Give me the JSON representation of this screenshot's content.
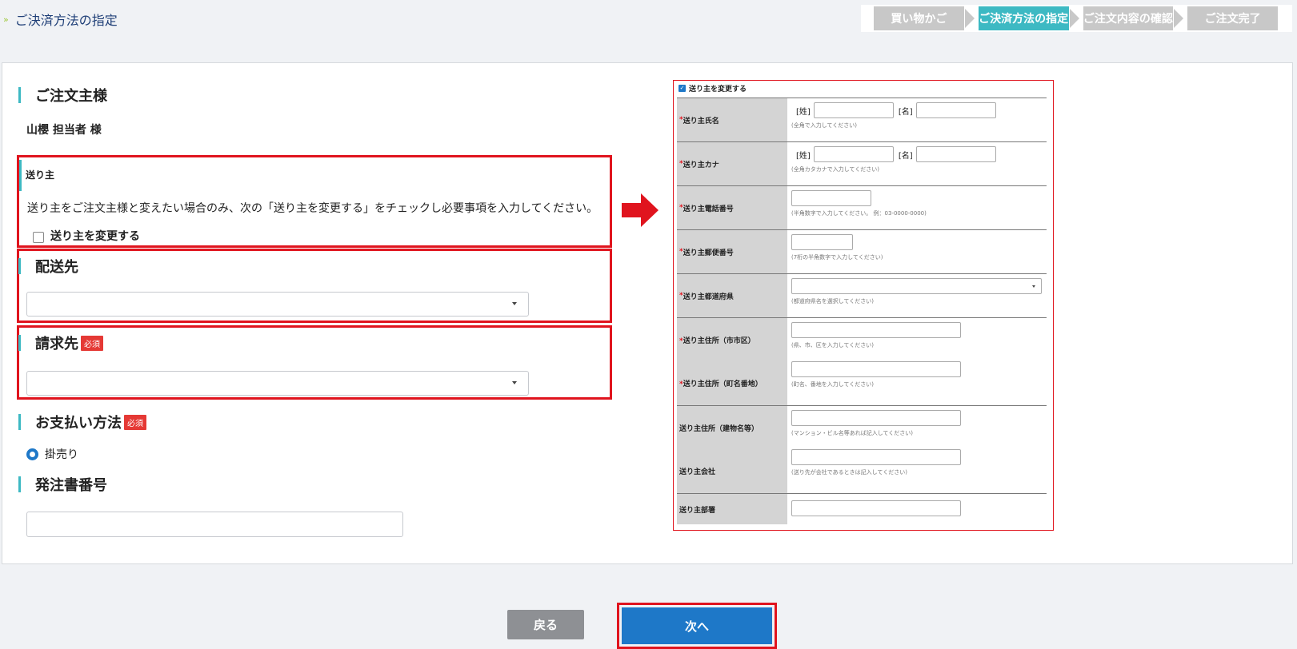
{
  "header": {
    "title": "ご決済方法の指定"
  },
  "steps": [
    {
      "label": "買い物かご",
      "active": false
    },
    {
      "label": "ご決済方法の指定",
      "active": true
    },
    {
      "label": "ご注文内容の確認",
      "active": false
    },
    {
      "label": "ご注文完了",
      "active": false
    }
  ],
  "orderer": {
    "title": "ご注文主様",
    "name": "山櫻 担当者 様"
  },
  "sender": {
    "label": "送り主",
    "description": "送り主をご注文主様と変えたい場合のみ、次の「送り主を変更する」をチェックし必要事項を入力してください。",
    "checkbox_label": "送り主を変更する",
    "checked": false
  },
  "delivery": {
    "title": "配送先",
    "value": ""
  },
  "billing": {
    "title": "請求先",
    "required_badge": "必須",
    "value": ""
  },
  "payment": {
    "title": "お支払い方法",
    "required_badge": "必須",
    "option": "掛売り"
  },
  "po_number": {
    "title": "発注書番号",
    "value": ""
  },
  "preview": {
    "checkbox_label": "送り主を変更する",
    "rows": {
      "name": {
        "label": "送り主氏名",
        "sei": "[姓]",
        "mei": "[名]",
        "note": "(全角で入力してください)"
      },
      "kana": {
        "label": "送り主カナ",
        "sei": "[姓]",
        "mei": "[名]",
        "note": "(全角カタカナで入力してください)"
      },
      "phone": {
        "label": "送り主電話番号",
        "note": "(半角数字で入力してください。 例：03-0000-0000)"
      },
      "zip": {
        "label": "送り主郵便番号",
        "note": "(7桁の半角数字で入力してください)"
      },
      "pref": {
        "label": "送り主都道府県",
        "note": "(都道府県名を選択してください)"
      },
      "city": {
        "label": "送り主住所（市市区）",
        "note": "(県、市、区を入力してください)"
      },
      "town": {
        "label": "送り主住所（町名番地）",
        "note": "(町名、番地を入力してください)"
      },
      "building": {
        "label": "送り主住所（建物名等）",
        "note": "(マンション・ビル名等あれば記入してください)"
      },
      "company": {
        "label": "送り主会社",
        "note": "(送り先が会社であるときは記入してください)"
      },
      "dept": {
        "label": "送り主部署"
      }
    }
  },
  "buttons": {
    "back": "戻る",
    "next": "次へ"
  }
}
